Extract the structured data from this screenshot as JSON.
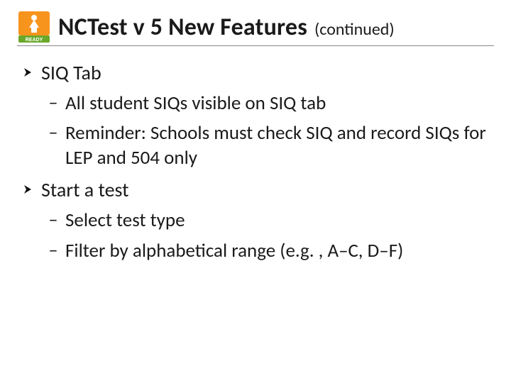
{
  "logo": {
    "label": "READY",
    "accent": "#f7941d",
    "green": "#6aa82b"
  },
  "title": {
    "main": "NCTest v 5 New Features",
    "continued": "(continued)"
  },
  "sections": [
    {
      "heading": "SIQ Tab",
      "items": [
        "All student SIQs visible on SIQ tab",
        "Reminder: Schools must check SIQ and record SIQs for LEP and 504 only"
      ]
    },
    {
      "heading": "Start a test",
      "items": [
        "Select test type",
        "Filter by alphabetical range (e.g. , A–C, D–F)"
      ]
    }
  ],
  "glyphs": {
    "dash": "‒"
  }
}
